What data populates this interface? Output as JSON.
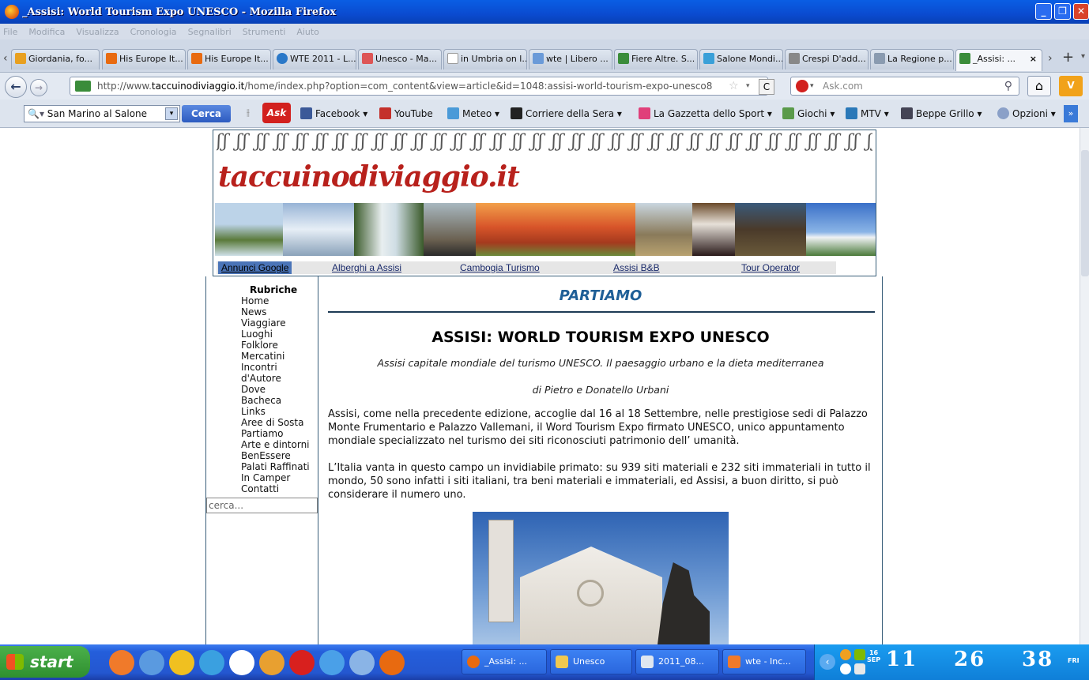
{
  "window": {
    "title": "_Assisi: World Tourism Expo UNESCO - Mozilla Firefox"
  },
  "menu": [
    "File",
    "Modifica",
    "Visualizza",
    "Cronologia",
    "Segnalibri",
    "Strumenti",
    "Aiuto"
  ],
  "tabs": [
    "Giordania, fo...",
    "His Europe It...",
    "His Europe It...",
    "WTE 2011 - L...",
    "Unesco - Ma...",
    "in Umbria on l...",
    "wte | Libero ...",
    "Fiere Altre. S...",
    "Salone Mondi...",
    "Crespi D'add...",
    "La Regione p...",
    "_Assisi: ..."
  ],
  "nav": {
    "url_prefix": "http://www.",
    "url_domain": "taccuinodiviaggio.it",
    "url_rest": "/home/index.php?option=com_content&view=article&id=1048:assisi-world-tourism-expo-unesco8",
    "search_placeholder": "Ask.com"
  },
  "toolbar": {
    "search_value": "San Marino al Salone",
    "search_button": "Cerca",
    "links": [
      "Facebook",
      "YouTube",
      "Meteo",
      "Corriere della Sera",
      "La Gazzetta dello Sport",
      "Giochi",
      "MTV",
      "Beppe Grillo",
      "Opzioni"
    ]
  },
  "site": {
    "logo": "taccuinodiviaggio.it",
    "ads": [
      "Annunci Google",
      "Alberghi a Assisi",
      "Cambogia Turismo",
      "Assisi B&B",
      "Tour Operator"
    ]
  },
  "sidebar": {
    "heading": "Rubriche",
    "items": [
      "Home",
      "News",
      "Viaggiare",
      "Luoghi",
      "Folklore",
      "Mercatini",
      "Incontri",
      "d'Autore",
      "Dove",
      "Bacheca",
      "Links",
      "Aree di Sosta",
      "Partiamo",
      "Arte e dintorni",
      "BenEssere",
      "Palati Raffinati",
      "In Camper",
      "Contatti"
    ],
    "search_placeholder": "cerca..."
  },
  "article": {
    "section": "PARTIAMO",
    "title": "ASSISI: WORLD TOURISM EXPO UNESCO",
    "subtitle": "Assisi capitale mondiale del turismo UNESCO. Il paesaggio urbano e la dieta mediterranea",
    "author": "di Pietro e Donatello Urbani",
    "p1": "Assisi, come nella precedente edizione, accoglie dal 16 al 18 Settembre, nelle prestigiose sedi di Palazzo Monte Frumentario e Palazzo Vallemani,  il Word Tourism Expo firmato UNESCO, unico appuntamento mondiale specializzato nel turismo dei siti riconosciuti patrimonio  dell’ umanità.",
    "p2": "L’Italia vanta in questo campo un invidiabile primato:  su 939 siti materiali e 232 siti immateriali in tutto il mondo, 50 sono infatti i siti italiani, tra beni materiali e immateriali, ed Assisi,  a buon diritto, si può considerare il numero uno."
  },
  "taskbar": {
    "start": "start",
    "buttons": [
      "_Assisi: ...",
      "Unesco",
      "2011_08...",
      "wte - Inc..."
    ],
    "date_day": "16",
    "date_month": "SEP",
    "clock": [
      "11",
      "26",
      "38"
    ],
    "weekday": "FRI"
  },
  "colors": {
    "accent": "#1f5f97",
    "logo": "#b8211c",
    "border": "#3a5f7a"
  }
}
